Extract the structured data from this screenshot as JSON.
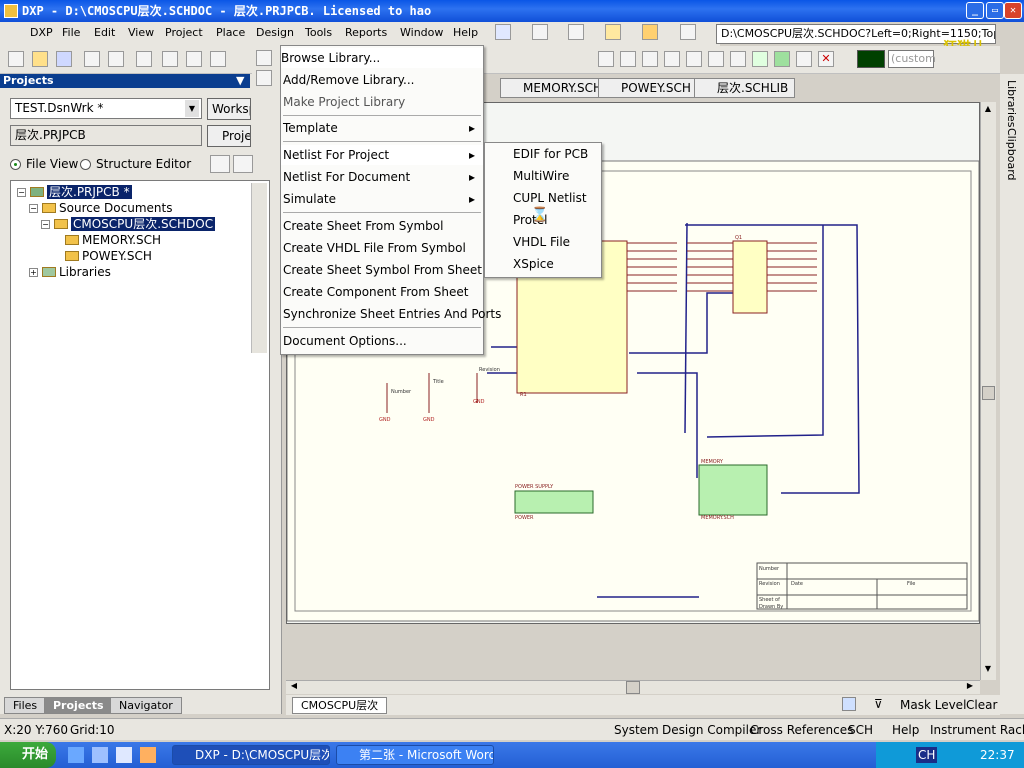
{
  "window": {
    "title": "DXP - D:\\CMOSCPU层次.SCHDOC - 层次.PRJPCB. Licensed to hao",
    "address": "D:\\CMOSCPU层次.SCHDOC?Left=0;Right=1150;Top=",
    "custom_field": "(custom"
  },
  "menubar": [
    "DXP",
    "File",
    "Edit",
    "View",
    "Project",
    "Place",
    "Design",
    "Tools",
    "Reports",
    "Window",
    "Help"
  ],
  "projects_panel": {
    "title": "Projects",
    "workspace": "TEST.DsnWrk *",
    "workspace_button": "Workspace",
    "project": "层次.PRJPCB",
    "project_button": "Project",
    "view_file": "File View",
    "view_structure": "Structure Editor",
    "tree": {
      "root": "层次.PRJPCB *",
      "source_docs": "Source Documents",
      "cmoscpu": "CMOSCPU层次.SCHDOC",
      "memory": "MEMORY.SCH",
      "powey": "POWEY.SCH",
      "libraries": "Libraries"
    },
    "tabs": [
      "Files",
      "Projects",
      "Navigator"
    ]
  },
  "doc_tabs": [
    "MEMORY.SCH",
    "POWEY.SCH",
    "层次.SCHLIB"
  ],
  "design_menu": [
    {
      "label": "Browse Library...",
      "sub": false
    },
    {
      "label": "Add/Remove Library...",
      "sub": false
    },
    {
      "label": "Make Project Library",
      "sub": false
    },
    {
      "label": "Template",
      "sub": true
    },
    {
      "label": "Netlist For Project",
      "sub": true
    },
    {
      "label": "Netlist For Document",
      "sub": true
    },
    {
      "label": "Simulate",
      "sub": true
    },
    {
      "label": "Create Sheet From Symbol",
      "sub": false
    },
    {
      "label": "Create VHDL File From Symbol",
      "sub": false
    },
    {
      "label": "Create Sheet Symbol From Sheet",
      "sub": false
    },
    {
      "label": "Create Component From Sheet",
      "sub": false
    },
    {
      "label": "Synchronize Sheet Entries And Ports",
      "sub": false
    },
    {
      "label": "Document Options...",
      "sub": false
    }
  ],
  "netlist_submenu": [
    "EDIF for PCB",
    "MultiWire",
    "CUPL Netlist",
    "Protel",
    "VHDL File",
    "XSpice"
  ],
  "sheet_tab": "CMOSCPU层次",
  "bottom_right": {
    "mask_level": "Mask Level",
    "clear": "Clear"
  },
  "side_panels": [
    "Libraries",
    "Clipboard"
  ],
  "status": {
    "coords": "X:20 Y:760",
    "grid": "Grid:10",
    "buttons": [
      "System",
      "Design Compiler",
      "Cross References",
      "SCH",
      "Help",
      "Instrument Racks"
    ]
  },
  "taskbar": {
    "start": "开始",
    "tasks": [
      "DXP - D:\\CMOSCPU层次....",
      "第二张 - Microsoft Word"
    ],
    "lang": "CH",
    "clock": "22:37"
  },
  "logo_text": "狂猫儿",
  "schematic": {
    "labels": [
      "POWER SUPPLY",
      "POWER",
      "VCC",
      "GND",
      "MEMORY",
      "MEMORY.SCH",
      "U1",
      "U2",
      "C1",
      "C2",
      "R1",
      "Q1",
      "Title",
      "Size",
      "Number",
      "Revision",
      "Date",
      "File",
      "Sheet of",
      "Drawn By"
    ]
  }
}
